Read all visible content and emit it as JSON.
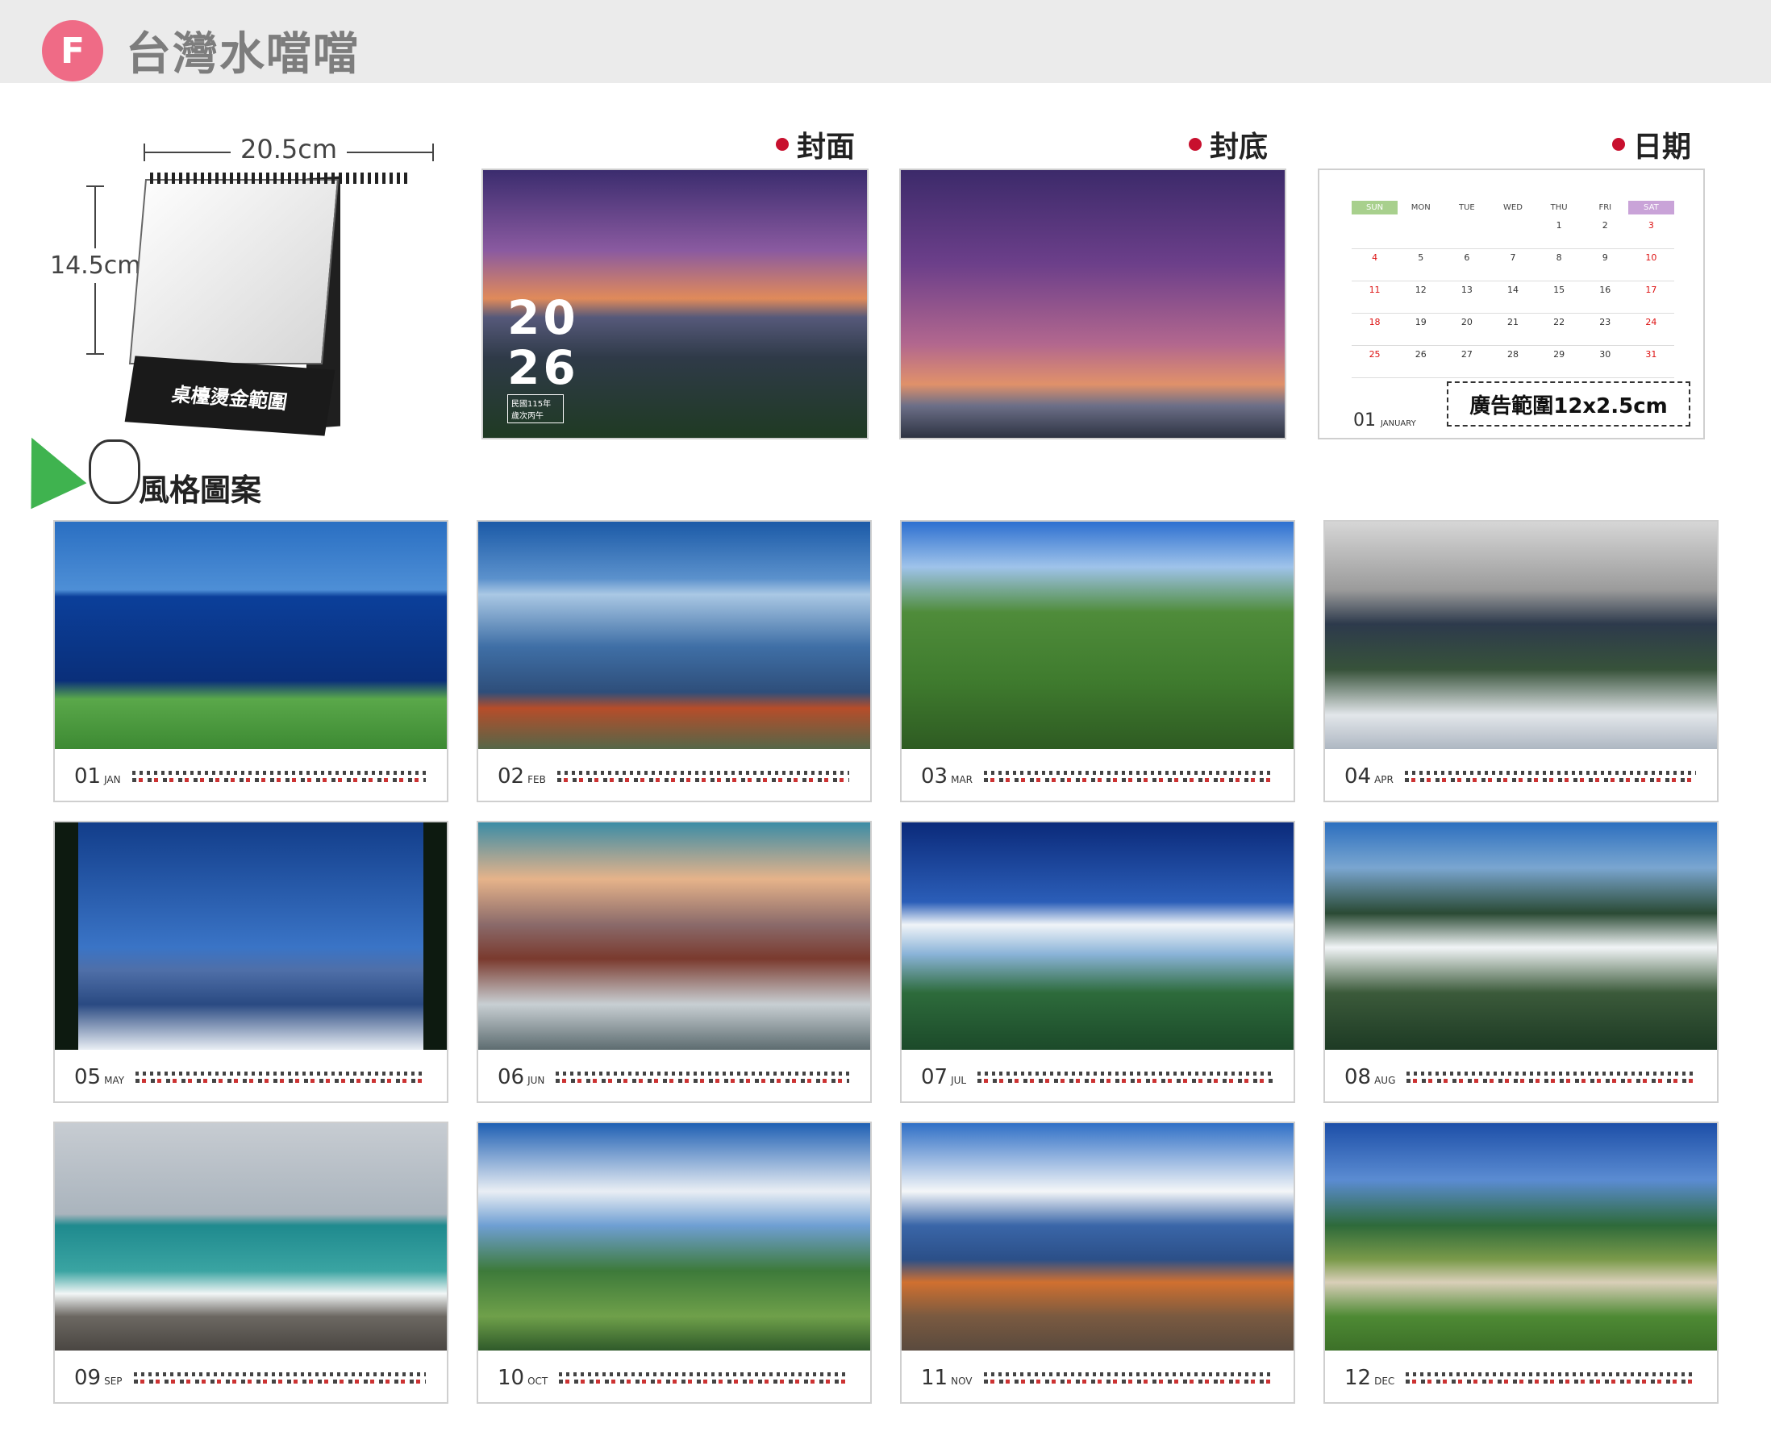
{
  "header": {
    "badge": "F",
    "title": "台灣水噹噹"
  },
  "illustration": {
    "width_label": "20.5cm",
    "height_label": "14.5cm",
    "foil_label": "桌檯燙金範圍"
  },
  "sections": {
    "cover": "封面",
    "back": "封底",
    "date": "日期",
    "style": "風格圖案"
  },
  "cover": {
    "year_top": "20",
    "year_bottom": "26",
    "roc": "民國115年 歲次丙午"
  },
  "january": {
    "days": [
      "SUN",
      "MON",
      "TUE",
      "WED",
      "THU",
      "FRI",
      "SAT"
    ],
    "dates": [
      "",
      "",
      "",
      "",
      "1",
      "2",
      "3",
      "4",
      "5",
      "6",
      "7",
      "8",
      "9",
      "10",
      "11",
      "12",
      "13",
      "14",
      "15",
      "16",
      "17",
      "18",
      "19",
      "20",
      "21",
      "22",
      "23",
      "24",
      "25",
      "26",
      "27",
      "28",
      "29",
      "30",
      "31"
    ],
    "ad_text": "廣告範圍12x2.5cm",
    "month_num": "01",
    "month_name": "JANUARY"
  },
  "months": [
    {
      "num": "01",
      "name": "JAN"
    },
    {
      "num": "02",
      "name": "FEB"
    },
    {
      "num": "03",
      "name": "MAR"
    },
    {
      "num": "04",
      "name": "APR"
    },
    {
      "num": "05",
      "name": "MAY"
    },
    {
      "num": "06",
      "name": "JUN"
    },
    {
      "num": "07",
      "name": "JUL"
    },
    {
      "num": "08",
      "name": "AUG"
    },
    {
      "num": "09",
      "name": "SEP"
    },
    {
      "num": "10",
      "name": "OCT"
    },
    {
      "num": "11",
      "name": "NOV"
    },
    {
      "num": "12",
      "name": "DEC"
    }
  ],
  "colors": {
    "badge": "#ef6b86",
    "dot": "#c8102e",
    "sun_head": "#a8d08d",
    "sat_head": "#c9a3d8"
  }
}
